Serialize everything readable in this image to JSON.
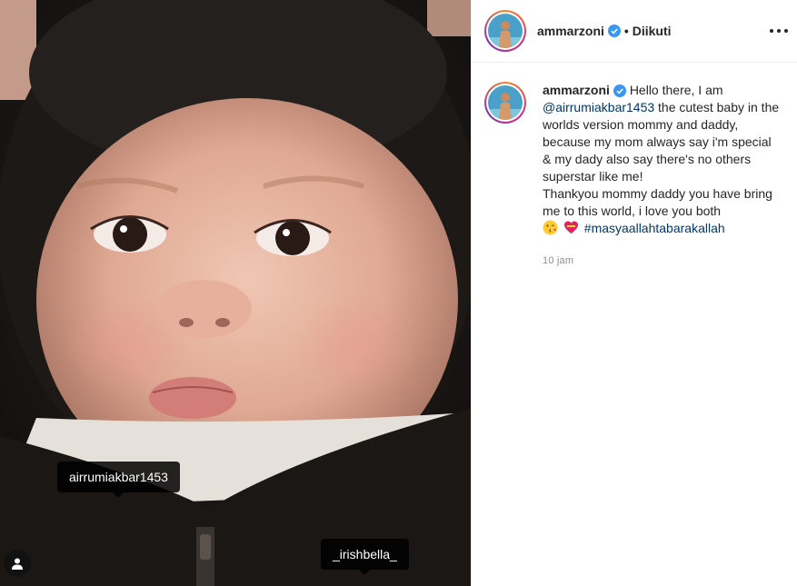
{
  "post": {
    "username": "ammarzoni",
    "follow_status": "• Diikuti"
  },
  "photo": {
    "tags": [
      {
        "label": "airrumiakbar1453"
      },
      {
        "label": "_irishbella_"
      }
    ]
  },
  "caption": {
    "username": "ammarzoni",
    "intro": "Hello there, I am",
    "mention": "@airrumiakbar1453",
    "body_1": "the cutest baby in the worlds version mommy and daddy, because my mom always say i'm special & my dady also say there's no others superstar like me!",
    "body_2": "Thankyou mommy daddy you have bring me to this world, i love you both",
    "emojis": [
      "kissing-face-icon",
      "heart-with-ribbon-icon"
    ],
    "hashtag": "#masyaallahtabarakallah",
    "timestamp": "10 jam"
  },
  "colors": {
    "verified": "#3897f0",
    "link": "#00376b",
    "meta": "#8e8e8e"
  }
}
